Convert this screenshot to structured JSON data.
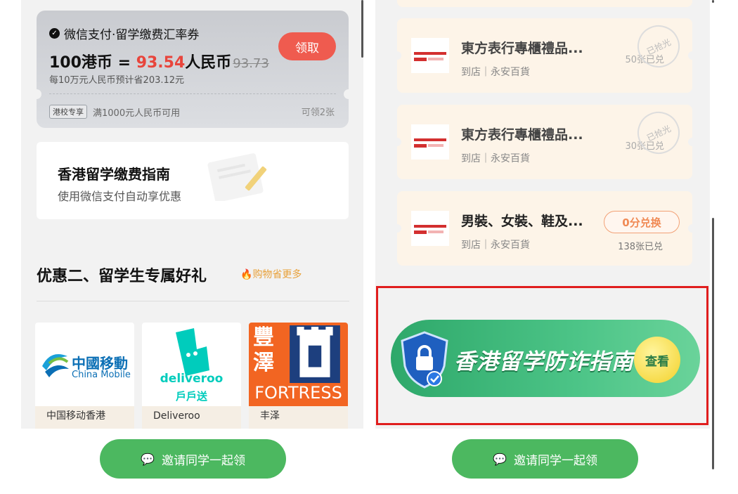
{
  "left": {
    "coupon": {
      "header": "微信支付·留学缴费汇率券",
      "rate_prefix": "100港币 = ",
      "rate_value": "93.54",
      "rate_suffix": "人民币",
      "rate_original": "93.73",
      "saving": "每10万元人民币预计省203.12元",
      "claim_button": "领取",
      "tag": "港校专享",
      "condition": "满1000元人民币可用",
      "claim_count": "可领2张"
    },
    "guide": {
      "title": "香港留学缴费指南",
      "subtitle": "使用微信支付自动享优惠"
    },
    "section": {
      "title": "优惠二、留学生专属好礼",
      "subtitle": "购物省更多"
    },
    "brands": [
      {
        "name": "中国移动香港",
        "logo_text": "中國移動",
        "logo_sub": "China Mobile"
      },
      {
        "name": "Deliveroo",
        "logo_text": "deliveroo",
        "logo_sub": "戶戶送"
      },
      {
        "name": "丰泽",
        "logo_text": "豐澤",
        "logo_sub": "FORTRESS"
      }
    ],
    "invite_button": "邀请同学一起领"
  },
  "right": {
    "cards": [
      {
        "title": "東方表行專櫃禮品...",
        "store": "到店｜永安百貨",
        "count": "50张已兑",
        "stamp": "已抢光"
      },
      {
        "title": "東方表行專櫃禮品...",
        "store": "到店｜永安百貨",
        "count": "30张已兑",
        "stamp": "已抢光"
      },
      {
        "title": "男裝、女裝、鞋及...",
        "store": "到店｜永安百貨",
        "count": "138张已兑",
        "button": "0分兑换"
      }
    ],
    "banner": {
      "text": "香港留学防诈指南",
      "button": "查看"
    },
    "invite_button": "邀请同学一起领"
  },
  "colors": {
    "accent_red": "#e8453c",
    "invite_green": "#4cb860",
    "highlight_border": "#e01e1e"
  }
}
